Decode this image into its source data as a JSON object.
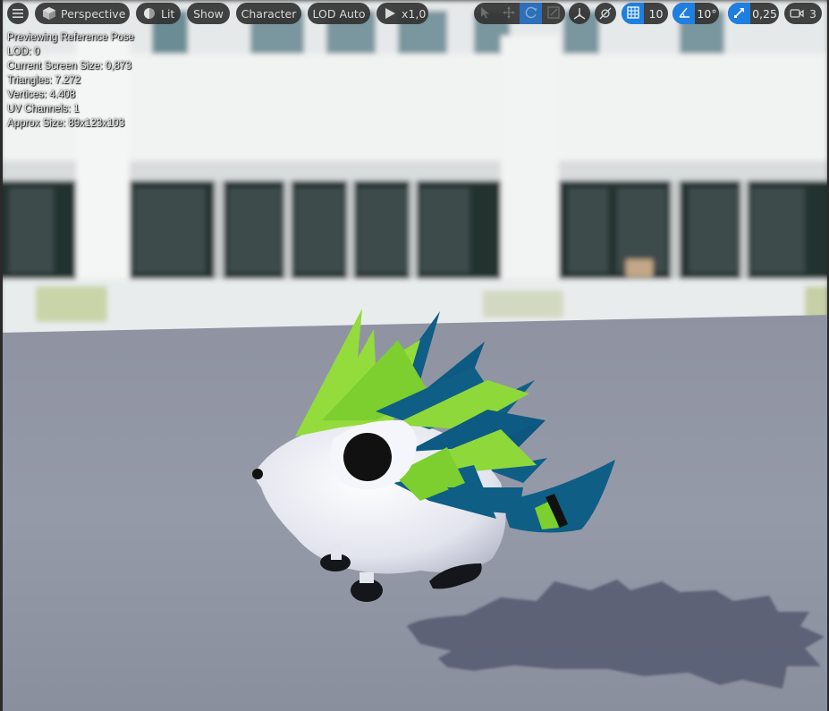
{
  "toolbar": {
    "menu_icon": "hamburger-icon",
    "perspective_label": "Perspective",
    "lit_label": "Lit",
    "show_label": "Show",
    "character_label": "Character",
    "lod_label": "LOD Auto",
    "playback_rate": "x1,0",
    "grid_snap_value": "10",
    "rotation_snap_value": "10°",
    "scale_snap_value": "0,25",
    "camera_speed_value": "3"
  },
  "stats": {
    "mode": "Previewing Reference Pose",
    "lod": "LOD: 0",
    "screen_size": "Current Screen Size: 0,873",
    "triangles": "Triangles: 7.272",
    "vertices": "Vertices: 4.408",
    "uv_channels": "UV Channels: 1",
    "approx_size": "Approx Size: 89x123x103"
  },
  "colors": {
    "accent": "#1f7fe0",
    "floor": "#8e93a3",
    "spike_green": "#8fd83a",
    "spike_blue": "#0f5e86",
    "body_white": "#e6e8f0"
  }
}
